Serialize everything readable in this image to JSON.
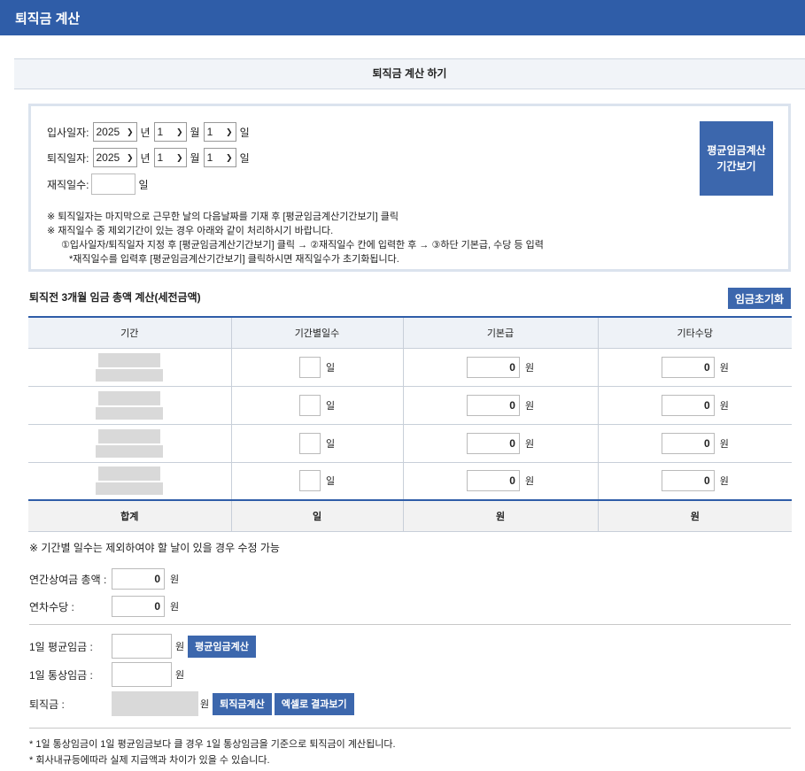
{
  "header": {
    "title": "퇴직금 계산"
  },
  "section": {
    "title": "퇴직금 계산 하기"
  },
  "dates": {
    "start_label": "입사일자:",
    "end_label": "퇴직일자:",
    "days_label": "재직일수:",
    "year_value": "2025",
    "month_value": "1",
    "day_value": "1",
    "year_unit": "년",
    "month_unit": "월",
    "day_unit": "일",
    "days_unit": "일",
    "period_button": "평균임금계산\n기간보기"
  },
  "notes": [
    "※ 퇴직일자는 마지막으로 근무한 날의 다음날짜를 기재 후 [평균임금계산기간보기] 클릭",
    "※ 재직일수 중 제외기간이 있는 경우 아래와 같이 처리하시기 바랍니다.",
    "①입사일자/퇴직일자 지정 후 [평균임금계산기간보기] 클릭 → ②재직일수 칸에 입력한 후 → ③하단 기본급, 수당 등 입력",
    "*재직일수를 입력후 [평균임금계산기간보기] 클릭하시면 재직일수가 초기화됩니다."
  ],
  "wage_section": {
    "title": "퇴직전 3개월 임금 총액 계산(세전금액)",
    "reset_button": "임금초기화"
  },
  "wage_table": {
    "headers": [
      "기간",
      "기간별일수",
      "기본급",
      "기타수당"
    ],
    "rows": [
      {
        "basic": "0",
        "other": "0"
      },
      {
        "basic": "0",
        "other": "0"
      },
      {
        "basic": "0",
        "other": "0"
      },
      {
        "basic": "0",
        "other": "0"
      }
    ],
    "day_unit": "일",
    "won_unit": "원",
    "sum_label": "합계"
  },
  "note_days": "※ 기간별 일수는 제외하여야 할 날이 있을 경우 수정 가능",
  "bonus": {
    "label": "연간상여금 총액 :",
    "value": "0",
    "unit": "원"
  },
  "annual_leave": {
    "label": "연차수당 :",
    "value": "0",
    "unit": "원"
  },
  "avg_wage": {
    "label": "1일 평균임금 :",
    "unit": "원",
    "button": "평균임금계산"
  },
  "ordinary_wage": {
    "label": "1일 통상임금 :",
    "unit": "원"
  },
  "severance": {
    "label": "퇴직금 :",
    "unit": "원",
    "calc_button": "퇴직금계산",
    "excel_button": "엑셀로 결과보기"
  },
  "footnotes": [
    "* 1일 통상임금이 1일 평균임금보다 클 경우 1일 통상임금을 기준으로 퇴직금이 계산됩니다.",
    "* 회사내규등에따라 실제 지급액과 차이가 있을 수 있습니다."
  ]
}
